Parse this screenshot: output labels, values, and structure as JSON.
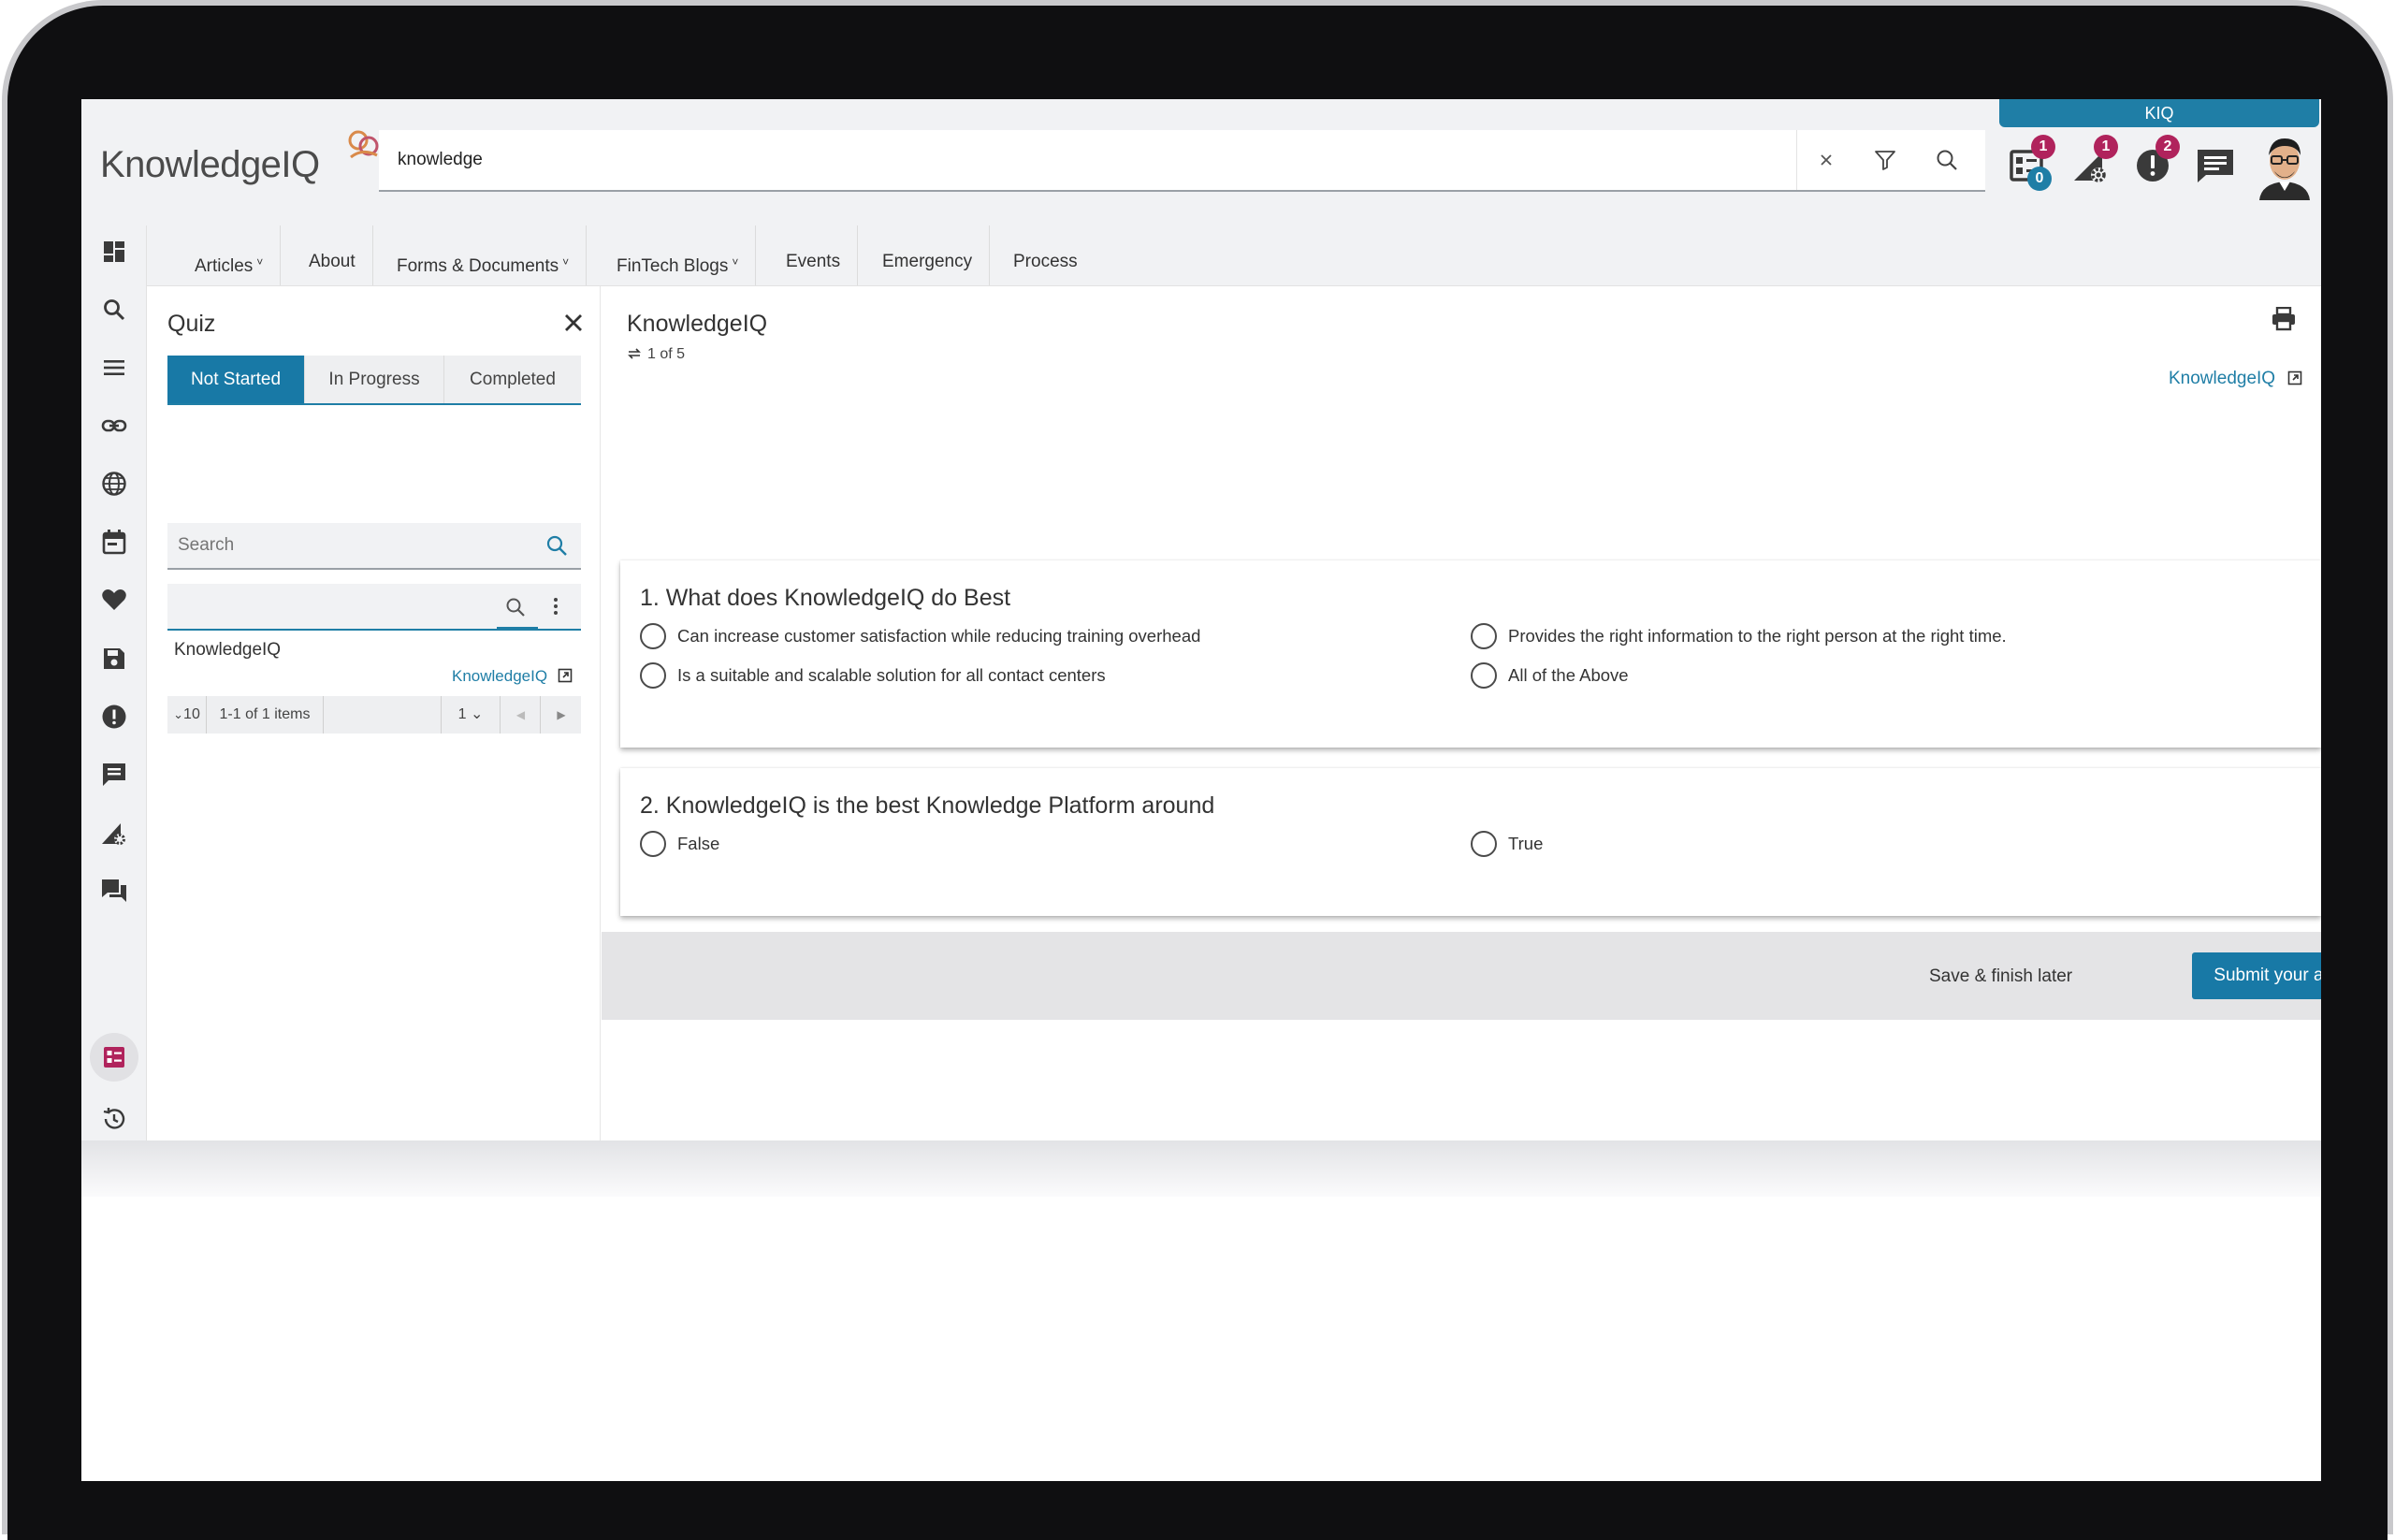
{
  "brand": {
    "logo_text": "KnowledgeIQ",
    "tab_label": "KIQ",
    "accent_color": "#1879a6",
    "badge_color": "#b0235c"
  },
  "search": {
    "value": "knowledge"
  },
  "header_icons": [
    {
      "name": "quiz-icon",
      "badge_red": "1",
      "badge_blue": "0"
    },
    {
      "name": "admin-settings-icon",
      "badge_red": "1"
    },
    {
      "name": "alert-icon",
      "badge_red": "2"
    },
    {
      "name": "chat-icon"
    },
    {
      "name": "avatar"
    }
  ],
  "nav": {
    "items": [
      {
        "label": "Articles",
        "has_menu": true
      },
      {
        "label": "About",
        "has_menu": false
      },
      {
        "label": "Forms & Documents",
        "has_menu": true
      },
      {
        "label": "FinTech Blogs",
        "has_menu": true
      },
      {
        "label": "Events",
        "has_menu": false
      },
      {
        "label": "Emergency",
        "has_menu": false
      },
      {
        "label": "Process",
        "has_menu": false
      }
    ]
  },
  "rail": {
    "icons": [
      "dashboard-icon",
      "search-icon",
      "menu-icon",
      "link-icon",
      "globe-icon",
      "calendar-icon",
      "favorites-icon",
      "save-icon",
      "alert-icon",
      "message-icon",
      "admin-settings-icon",
      "chat-icon",
      "quiz-icon",
      "history-icon"
    ],
    "active": "quiz-icon"
  },
  "quiz_panel": {
    "title": "Quiz",
    "tabs": [
      "Not Started",
      "In Progress",
      "Completed"
    ],
    "active_tab": "Not Started",
    "search_placeholder": "Search",
    "result": {
      "title": "KnowledgeIQ",
      "link": "KnowledgeIQ"
    },
    "pager": {
      "page_size": "10",
      "info": "1-1 of 1 items",
      "page": "1"
    }
  },
  "document": {
    "title": "KnowledgeIQ",
    "counter": "1 of 5",
    "link": "KnowledgeIQ"
  },
  "questions": [
    {
      "text": "1. What does KnowledgeIQ do Best",
      "options": [
        "Can increase customer satisfaction while reducing training overhead",
        "Provides the right information to the right person at the right time.",
        "Is a suitable and scalable solution for all contact centers",
        "All of the Above"
      ]
    },
    {
      "text": "2. KnowledgeIQ is the best Knowledge Platform around",
      "options": [
        "False",
        "True"
      ]
    }
  ],
  "actions": {
    "save_later": "Save & finish later",
    "submit": "Submit your answers"
  }
}
